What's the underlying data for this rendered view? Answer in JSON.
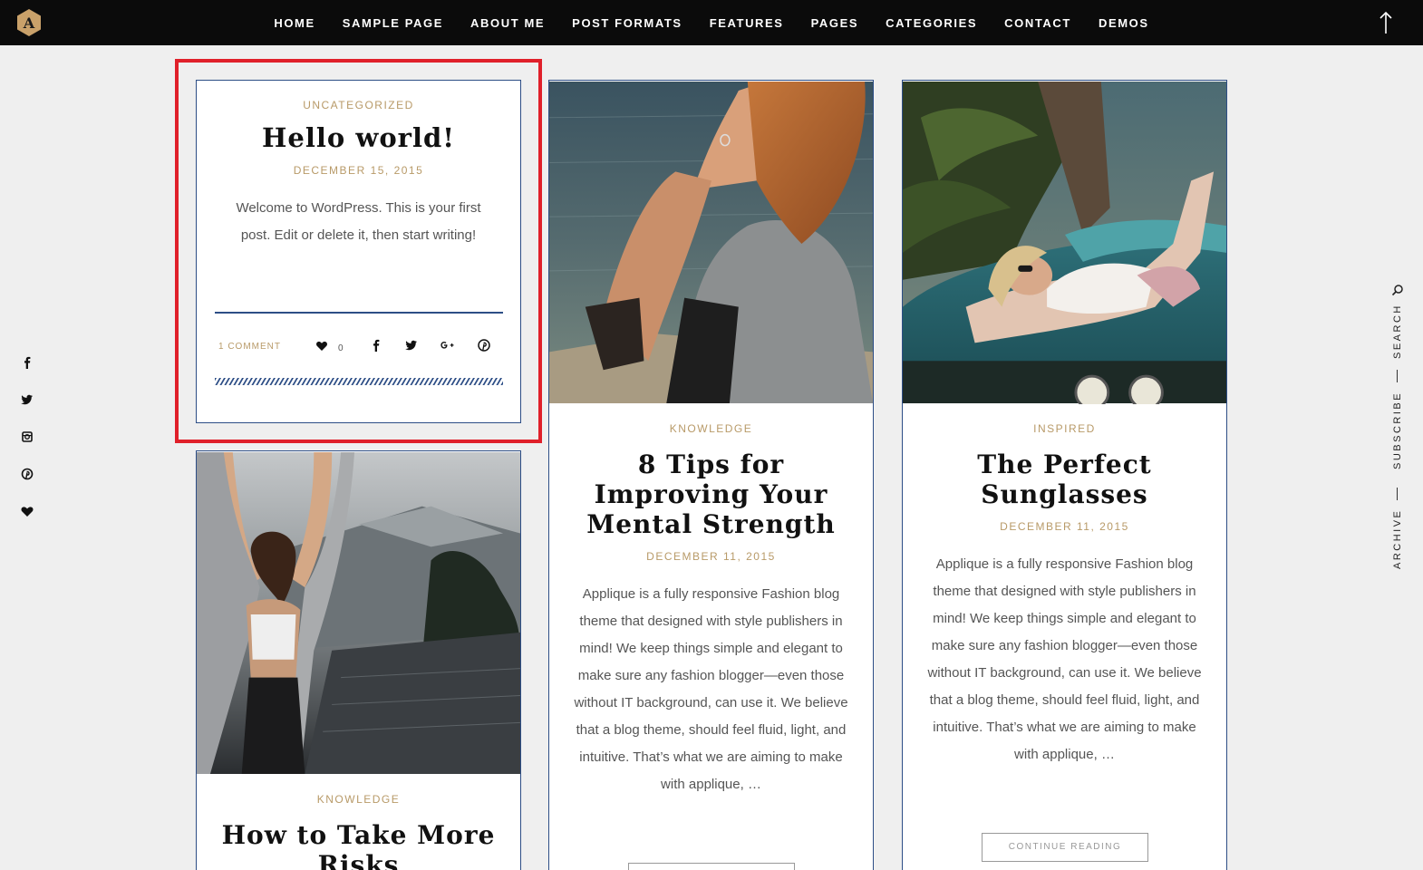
{
  "nav": {
    "logo_letter": "A",
    "items": [
      "HOME",
      "SAMPLE PAGE",
      "ABOUT ME",
      "POST FORMATS",
      "FEATURES",
      "PAGES",
      "CATEGORIES",
      "CONTACT",
      "DEMOS"
    ]
  },
  "social_left": [
    "facebook-icon",
    "twitter-icon",
    "instagram-icon",
    "pinterest-icon",
    "heart-icon"
  ],
  "rail": {
    "search": "SEARCH",
    "subscribe": "SUBSCRIBE",
    "archive": "ARCHIVE"
  },
  "posts": [
    {
      "category": "UNCATEGORIZED",
      "title": "Hello world!",
      "date": "DECEMBER 15, 2015",
      "excerpt": "Welcome to WordPress. This is your first post. Edit or delete it, then start writing!",
      "comments": "1 COMMENT",
      "likes": "0"
    },
    {
      "category": "KNOWLEDGE",
      "title": "8 Tips for Improving Your Mental Strength",
      "date": "DECEMBER 11, 2015",
      "excerpt": "Applique is a fully responsive Fashion blog theme that designed with style publishers in mind! We keep things simple and elegant to make sure any fashion blogger—even those without IT background, can use it. We believe that a blog theme, should feel fluid, light, and intuitive. That’s what we are aiming to make with applique, …"
    },
    {
      "category": "INSPIRED",
      "title": "The Perfect Sunglasses",
      "date": "DECEMBER 11, 2015",
      "excerpt": "Applique is a fully responsive Fashion blog theme that designed with style publishers in mind! We keep things simple and elegant to make sure any fashion blogger—even those without IT background, can use it. We believe that a blog theme, should feel fluid, light, and intuitive. That’s what we are aiming to make with applique, …",
      "button": "CONTINUE READING"
    },
    {
      "category": "KNOWLEDGE",
      "title": "How to Take More Risks"
    }
  ],
  "colors": {
    "accent": "#b89a68",
    "border": "#2d4e86",
    "highlight": "#e0202a"
  }
}
